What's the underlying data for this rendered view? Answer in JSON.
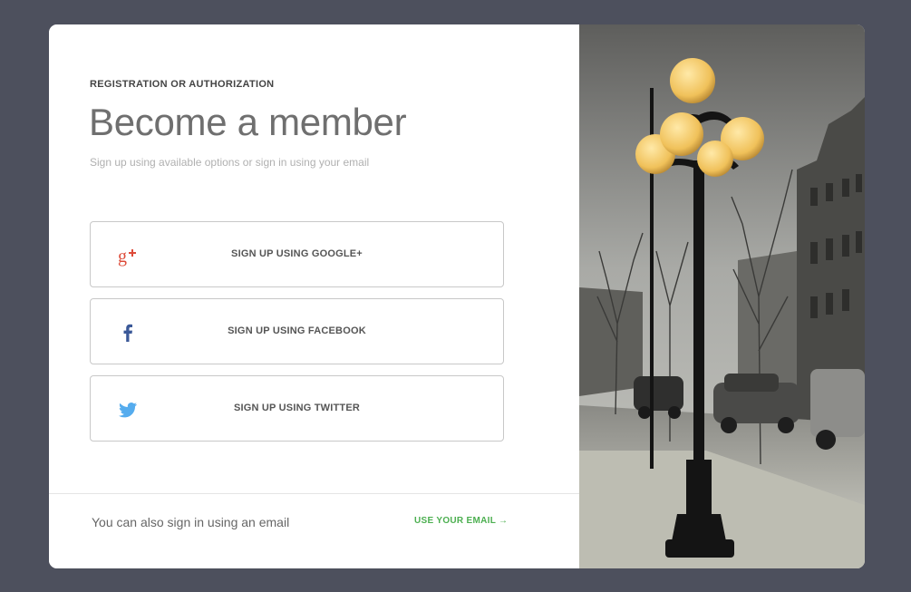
{
  "auth": {
    "eyebrow": "REGISTRATION OR AUTHORIZATION",
    "title": "Become a member",
    "subtitle": "Sign up using available options or sign in using your email"
  },
  "social_buttons": [
    {
      "label": "SIGN UP USING GOOGLE+",
      "icon": "google-plus-icon",
      "color": "#dd4b39"
    },
    {
      "label": "SIGN UP USING FACEBOOK",
      "icon": "facebook-icon",
      "color": "#3b5998"
    },
    {
      "label": "SIGN UP USING TWITTER",
      "icon": "twitter-icon",
      "color": "#55acee"
    }
  ],
  "footer": {
    "text": "You can also sign in using an email",
    "link_label": "USE YOUR EMAIL →",
    "link_color": "#4caf50"
  },
  "colors": {
    "background": "#4d505d",
    "card": "#ffffff"
  }
}
